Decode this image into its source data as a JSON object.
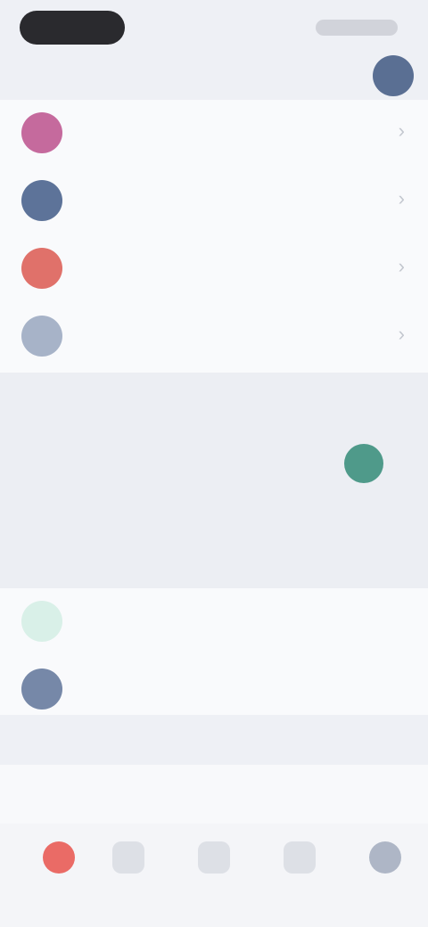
{
  "colors": {
    "row_1_icon": "#c56a9d",
    "row_2_icon": "#5d7399",
    "row_3_icon": "#e0716a",
    "row_4_icon": "#a7b3c8",
    "row_5_icon": "#d9f0e8",
    "row_6_icon": "#7688a8",
    "toggle_on": "#4f9a8a",
    "tab_active": "#ea6b66"
  },
  "icons": {
    "avatar": "avatar",
    "rows": [
      "circle-icon",
      "circle-icon",
      "circle-icon",
      "circle-icon",
      "circle-icon",
      "circle-icon"
    ],
    "toggle": "toggle-icon",
    "tabs": [
      "home-icon",
      "search-icon",
      "add-icon",
      "inbox-icon",
      "profile-icon"
    ]
  },
  "rows_top": [
    {
      "label": ""
    },
    {
      "label": ""
    },
    {
      "label": ""
    },
    {
      "label": ""
    }
  ],
  "section": {
    "item_1_label": "",
    "item_1_sub": "",
    "item_2_label": "",
    "item_2_sub": "",
    "item_3_label": "",
    "item_3_value": "",
    "heading": ""
  },
  "rows_bottom": [
    {
      "label": ""
    },
    {
      "label": ""
    }
  ],
  "logout": {
    "label": ""
  },
  "tabs": [
    {
      "label": ""
    },
    {
      "label": ""
    },
    {
      "label": ""
    },
    {
      "label": ""
    },
    {
      "label": ""
    }
  ]
}
